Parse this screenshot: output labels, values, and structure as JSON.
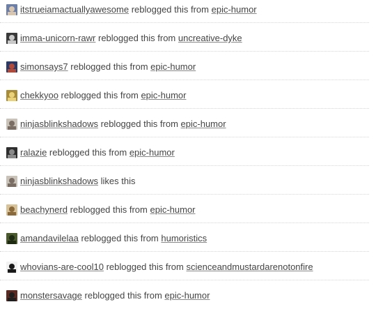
{
  "notes": [
    {
      "user": "itstrueiamactuallyawesome",
      "action": "reblogged this from",
      "source": "epic-humor",
      "avatar": {
        "name": "avatar-itstrueiamactuallyawesome",
        "bg": "#6b7fa8",
        "fg": "#d8c6b0"
      }
    },
    {
      "user": "imma-unicorn-rawr",
      "action": "reblogged this from",
      "source": "uncreative-dyke",
      "avatar": {
        "name": "avatar-imma-unicorn-rawr",
        "bg": "#3a3a3a",
        "fg": "#c9c9c9"
      }
    },
    {
      "user": "simonsays7",
      "action": "reblogged this from",
      "source": "epic-humor",
      "avatar": {
        "name": "avatar-simonsays7",
        "bg": "#2b3a66",
        "fg": "#b04a3a"
      }
    },
    {
      "user": "chekkyoo",
      "action": "reblogged this from",
      "source": "epic-humor",
      "avatar": {
        "name": "avatar-chekkyoo",
        "bg": "#a88c3a",
        "fg": "#e9d27a"
      }
    },
    {
      "user": "ninjasblinkshadows",
      "action": "reblogged this from",
      "source": "epic-humor",
      "avatar": {
        "name": "avatar-ninjasblinkshadows",
        "bg": "#c9c2b8",
        "fg": "#7a6e64"
      }
    },
    {
      "user": "ralazie",
      "action": "reblogged this from",
      "source": "epic-humor",
      "avatar": {
        "name": "avatar-ralazie",
        "bg": "#2e2e2e",
        "fg": "#8a8a8a"
      }
    },
    {
      "user": "ninjasblinkshadows",
      "action": "likes this",
      "source": "",
      "avatar": {
        "name": "avatar-ninjasblinkshadows-like",
        "bg": "#c9c2b8",
        "fg": "#7a6e64"
      }
    },
    {
      "user": "beachynerd",
      "action": "reblogged this from",
      "source": "epic-humor",
      "avatar": {
        "name": "avatar-beachynerd",
        "bg": "#d8c29a",
        "fg": "#8a6a3a"
      }
    },
    {
      "user": "amandavilelaa",
      "action": "reblogged this from",
      "source": "humoristics",
      "avatar": {
        "name": "avatar-amandavilelaa",
        "bg": "#4a5a2e",
        "fg": "#1e2a12"
      }
    },
    {
      "user": "whovians-are-cool10",
      "action": "reblogged this from",
      "source": "scienceandmustardarenotonfire",
      "avatar": {
        "name": "avatar-whovians-are-cool10",
        "bg": "#f2f2f2",
        "fg": "#1a1a1a"
      }
    },
    {
      "user": "monstersavage",
      "action": "reblogged this from",
      "source": "epic-humor",
      "avatar": {
        "name": "avatar-monstersavage",
        "bg": "#5a2a22",
        "fg": "#1e1e1e"
      }
    }
  ]
}
